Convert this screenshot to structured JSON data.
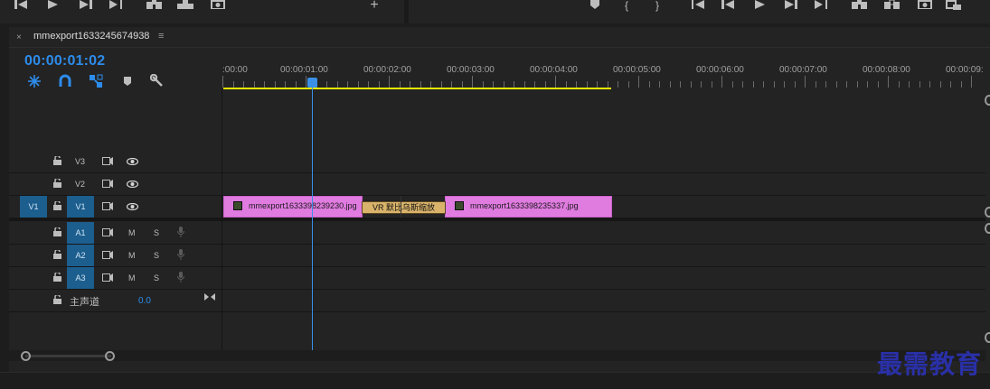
{
  "sequence": {
    "tab_close": "×",
    "tab_title": "mmexport1633245674938",
    "tab_menu": "≡",
    "timecode": "00:00:01:02"
  },
  "ruler": {
    "labels": [
      ":00:00",
      "00:00:01:00",
      "00:00:02:00",
      "00:00:03:00",
      "00:00:04:00",
      "00:00:05:00",
      "00:00:06:00",
      "00:00:07:00",
      "00:00:08:00",
      "00:00:09:"
    ]
  },
  "tracks": {
    "video": [
      {
        "label": "V3",
        "target": ""
      },
      {
        "label": "V2",
        "target": ""
      },
      {
        "label": "V1",
        "target": "V1"
      }
    ],
    "audio": [
      {
        "label": "A1",
        "m": "M",
        "s": "S"
      },
      {
        "label": "A2",
        "m": "M",
        "s": "S"
      },
      {
        "label": "A3",
        "m": "M",
        "s": "S"
      }
    ],
    "master": {
      "label": "主声道",
      "value": "0.0"
    }
  },
  "clips": {
    "clip1": "mmexport1633398239230.jpg",
    "transition": "VR 默比乌斯缩放",
    "clip2": "mmexport1633398235337.jpg"
  },
  "watermark": "最需教育",
  "colors": {
    "accent_blue": "#2d8ceb",
    "clip_pink": "#e07be0",
    "work_area_yellow": "#e6e600"
  },
  "icons": {
    "snap": "snap-icon",
    "linked": "linked-selection-icon",
    "add_marker": "add-marker-icon",
    "wrench": "wrench-icon",
    "lock": "lock-icon",
    "eye": "eye-icon",
    "mic": "mic-icon"
  }
}
